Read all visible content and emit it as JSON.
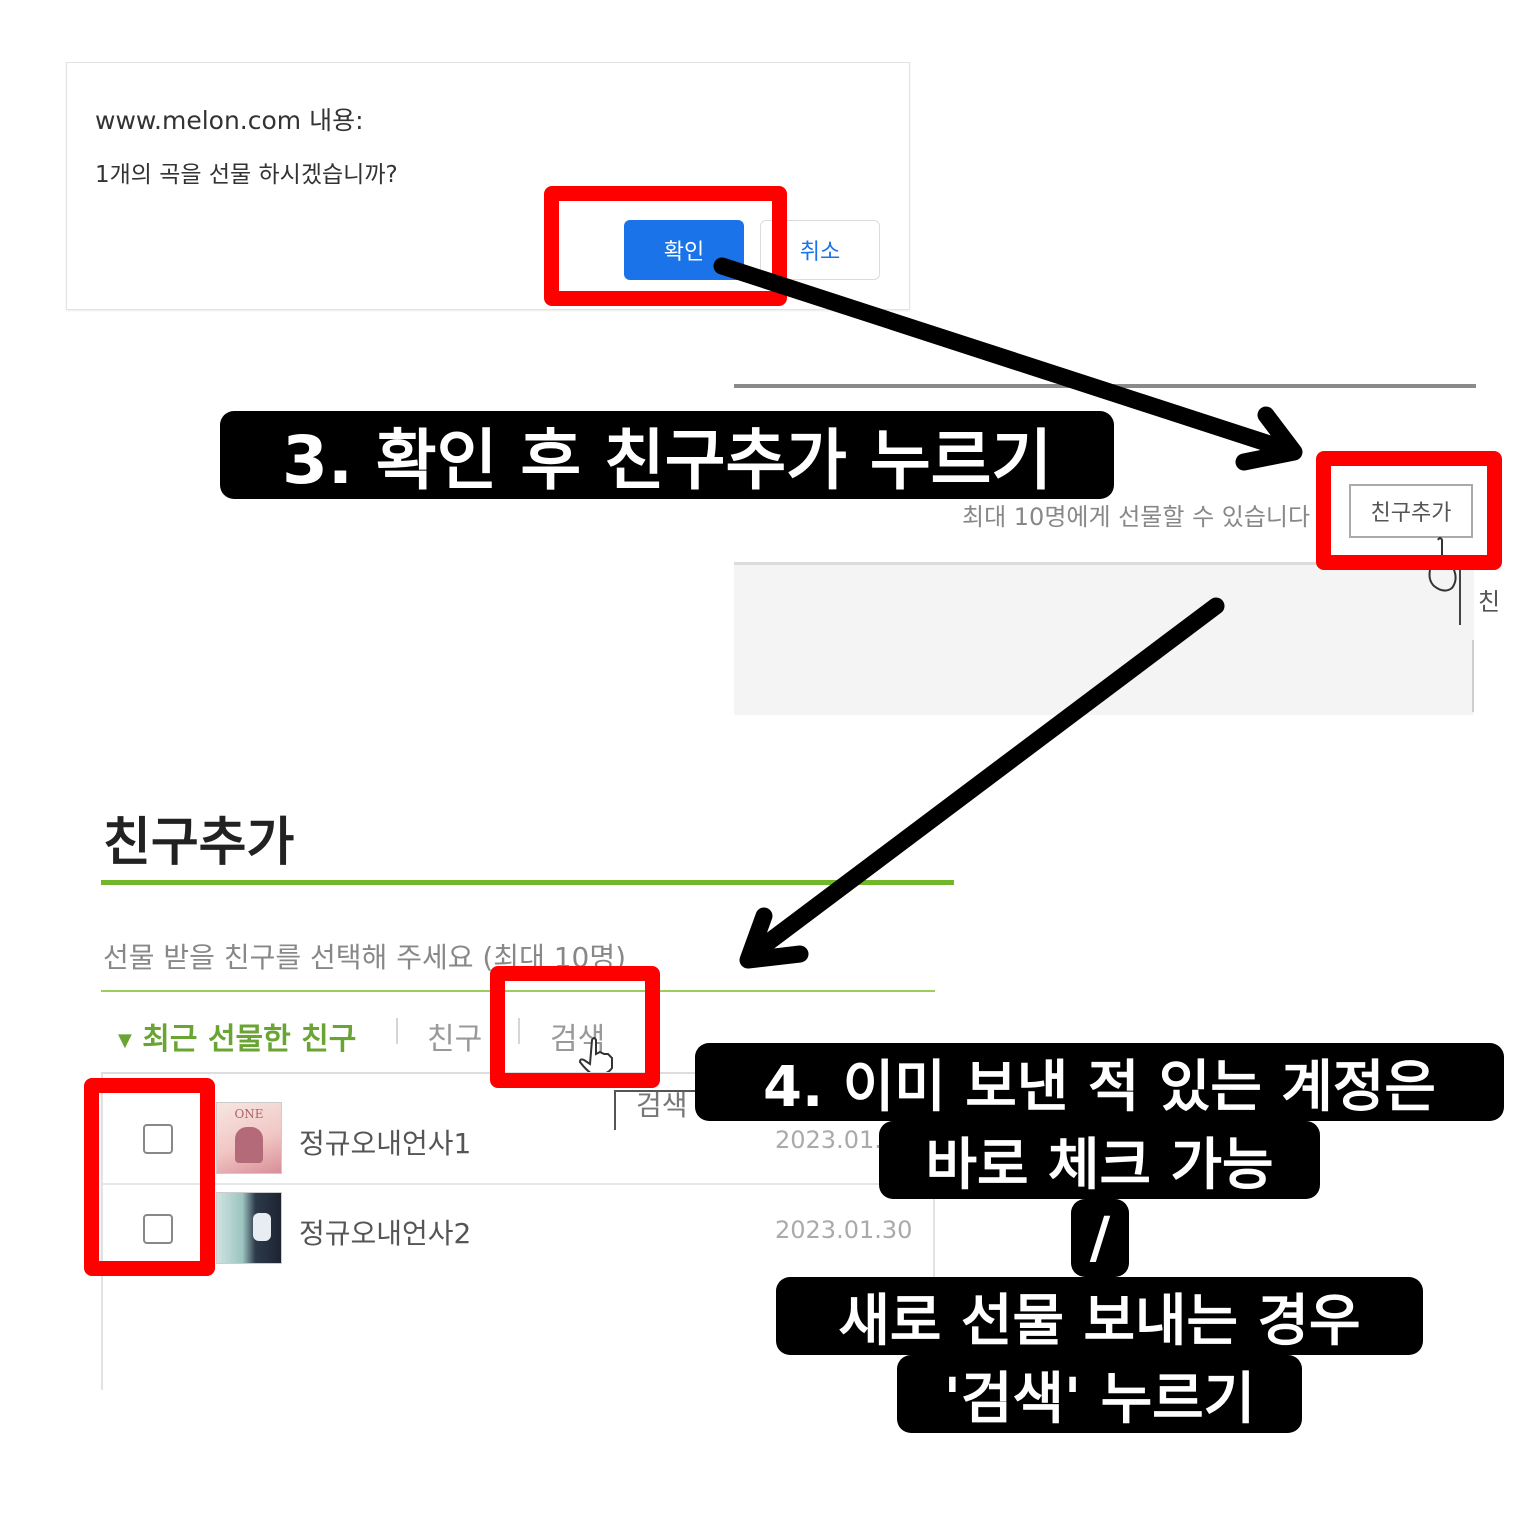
{
  "dialog": {
    "title": "www.melon.com 내용:",
    "message": "1개의 곡을 선물 하시겠습니까?",
    "ok_label": "확인",
    "cancel_label": "취소"
  },
  "panel2": {
    "notice": "최대 10명에게 선물할 수 있습니다",
    "add_friend_button": "친구추가",
    "partial_char": "친"
  },
  "panel3": {
    "title": "친구추가",
    "description": "선물 받을 친구를 선택해 주세요 (최대 10명)",
    "tabs": {
      "recent": "최근 선물한 친구",
      "friends": "친구",
      "search": "검색"
    },
    "tooltip": "검색",
    "rows": [
      {
        "name": "정규오내언사1",
        "date": "2023.01.30",
        "thumb_text": "ONE"
      },
      {
        "name": "정규오내언사2",
        "date": "2023.01.30"
      }
    ]
  },
  "captions": {
    "step3": "3. 확인 후 친구추가 누르기",
    "step4_line1": "4. 이미 보낸 적 있는 계정은",
    "step4_line2": "바로 체크 가능",
    "step4_line3": "/",
    "step4_line4": "새로 선물 보내는 경우",
    "step4_line5": "'검색' 누르기"
  },
  "colors": {
    "highlight_red": "#ff0000",
    "primary_blue": "#1a73e8",
    "melon_green": "#72b72a",
    "caption_bg": "#000000"
  }
}
